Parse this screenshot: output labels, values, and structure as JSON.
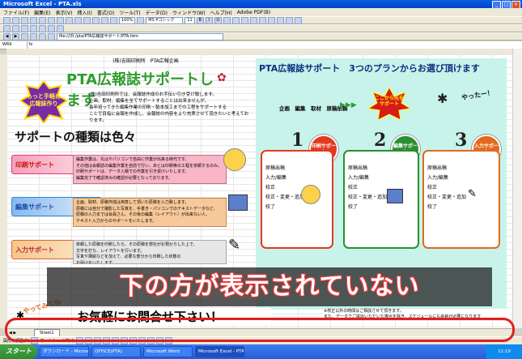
{
  "window": {
    "title": "Microsoft Excel - PTA.xls"
  },
  "menu": [
    "ファイル(F)",
    "編集(E)",
    "表示(V)",
    "挿入(I)",
    "書式(O)",
    "ツール(T)",
    "データ(D)",
    "ウィンドウ(W)",
    "ヘルプ(H)",
    "Adobe PDF(B)"
  ],
  "toolbar": {
    "zoom": "100%",
    "font": "MS Pゴシック",
    "size": "11"
  },
  "address": {
    "url": "file:///D:/pta/PTA広報誌サポート/PTA.htm",
    "cell": "W69"
  },
  "left": {
    "header": "(株)吉田印刷所　PTA広報企画",
    "title": "PTA広報誌サポートします",
    "badge": "もっと手軽に広報誌作り",
    "intro": "(株)吉田印刷所では、会報誌作成のお手伝い引き受け致します。\n企画、取材、編集を全てサポートすることは出来ませんが、\n長年培ってきた編集作業の印刷・製本加工までの工程をサポートする\nことで目指に会報を作成し、会報誌の内容をより充実させて頂きたいと考えております。",
    "heading": "サポートの種類は色々",
    "services": [
      {
        "label": "印刷サポート",
        "text": "編集作業は、丸はやパソコンで自由に作業が出来る時代です。\nその他は会報誌の編集作業を自前で行い、あとは印刷等の工程を依頼するのみ。\n印刷サポートは、データ入稿での作業を引き受けいたします。\n編集完了で確認済みの確認が必要となっております。"
      },
      {
        "label": "編集サポート",
        "text": "企画、取材、原稿作成は用意して頂いた原稿を入力致します。\n原稿には自分で撮影した写真を、手書き・パソコンでのテキストデータなど、\n原稿の入力までは会員さん、その後の編集（レイアウト）が出来ない人、\nテキスト入力からのサポートをいたします。"
      },
      {
        "label": "入力サポート",
        "text": "依頼した原稿を印刷したら、その原稿を弊社がお預かりした上で、\n文字を打ち、レイアウトを行います。\n写真や挿絵などを加えて、必要な部分から印刷した状態の\nお届けをいたします。"
      }
    ],
    "footer_jump": "やってみてね",
    "footer_banner": "お気軽にお問合せ下さい！"
  },
  "right": {
    "title": "PTA広報誌サポート　3つのプランからお選び頂けます",
    "steps": "企画　編集　取材　原稿依頼",
    "star": "ここから先をサポート",
    "yatta": "やったー！",
    "plans": [
      {
        "num": "1",
        "label": "印刷サポート",
        "items": [
          "原稿出稿",
          "入力/編集",
          "校正",
          "校正・変更・追加",
          "校了"
        ],
        "color": "#e23a1f"
      },
      {
        "num": "2",
        "label": "編集サポート",
        "items": [
          "原稿出稿",
          "入力/編集",
          "校正",
          "校正・変更・追加",
          "校了"
        ],
        "color": "#2a8f31"
      },
      {
        "num": "3",
        "label": "入力サポート",
        "items": [
          "原稿出稿",
          "入力/編集",
          "校正",
          "校正・変更・追加",
          "校了"
        ],
        "color": "#e36a1c"
      }
    ],
    "note": "※校正以外の時間はご相談させて頂きます。\nまた、データでご提出いただいた場合を除き、スケジュールにも余裕が必要になります"
  },
  "overlay": {
    "text": "下の方が表示されていない"
  },
  "sheet": {
    "tab": "Sheet1"
  },
  "drawbar": {
    "label": "図形の調整(R)",
    "autoshape": "オートシェイプ(U)"
  },
  "taskbar": {
    "start": "スタート",
    "items": [
      "ダウンロード - Microso",
      "OFFICE(PTA)",
      "Microsoft Word",
      "Microsoft Excel - PTA..."
    ],
    "clock": "11:19"
  }
}
